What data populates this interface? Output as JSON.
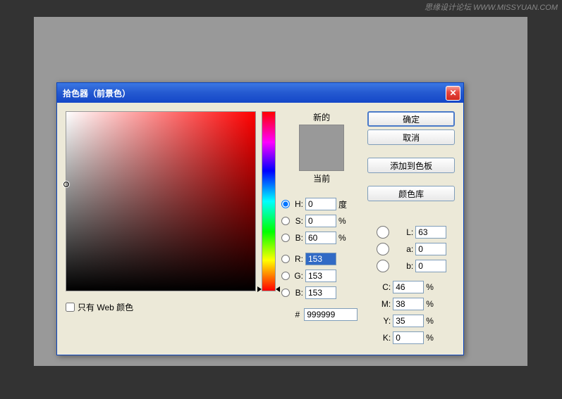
{
  "watermark": "思缘设计论坛 WWW.MISSYUAN.COM",
  "dialog": {
    "title": "拾色器（前景色）",
    "ok": "确定",
    "cancel": "取消",
    "add_swatch": "添加到色板",
    "color_lib": "颜色库",
    "new_label": "新的",
    "current_label": "当前",
    "web_only": "只有 Web 颜色",
    "hsb": {
      "h_label": "H:",
      "h": "0",
      "h_unit": "度",
      "s_label": "S:",
      "s": "0",
      "s_unit": "%",
      "b_label": "B:",
      "b": "60",
      "b_unit": "%"
    },
    "rgb": {
      "r_label": "R:",
      "r": "153",
      "g_label": "G:",
      "g": "153",
      "b_label": "B:",
      "b": "153"
    },
    "lab": {
      "l_label": "L:",
      "l": "63",
      "a_label": "a:",
      "a": "0",
      "b_label": "b:",
      "b": "0"
    },
    "cmyk": {
      "c_label": "C:",
      "c": "46",
      "m_label": "M:",
      "m": "38",
      "y_label": "Y:",
      "y": "35",
      "k_label": "K:",
      "k": "0",
      "unit": "%"
    },
    "hex_prefix": "#",
    "hex": "999999"
  }
}
